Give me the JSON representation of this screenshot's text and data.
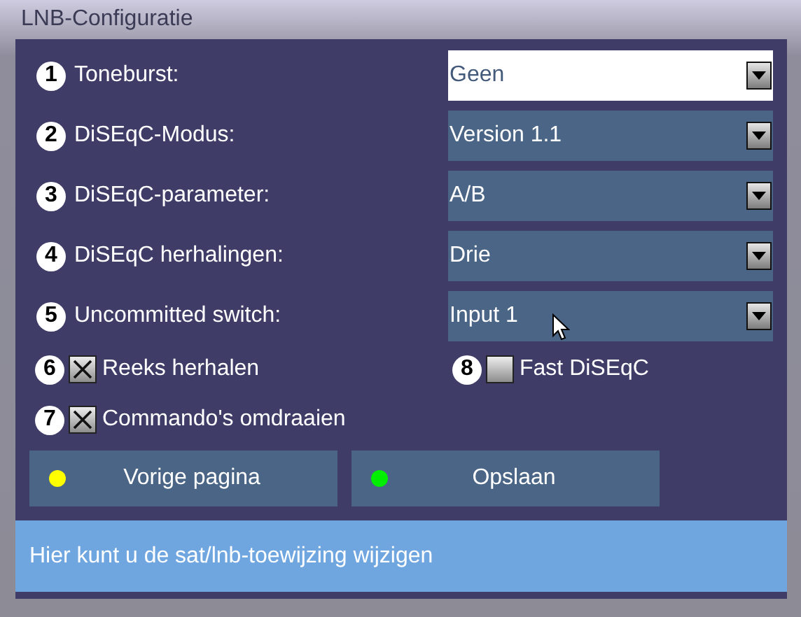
{
  "window": {
    "title": "LNB-Configuratie"
  },
  "settings": [
    {
      "number": "1",
      "label": "Toneburst:",
      "value": "Geen",
      "selected": true
    },
    {
      "number": "2",
      "label": "DiSEqC-Modus:",
      "value": "Version 1.1",
      "selected": false
    },
    {
      "number": "3",
      "label": "DiSEqC-parameter:",
      "value": "A/B",
      "selected": false
    },
    {
      "number": "4",
      "label": "DiSEqC herhalingen:",
      "value": "Drie",
      "selected": false
    },
    {
      "number": "5",
      "label": "Uncommitted switch:",
      "value": "Input 1",
      "selected": false
    }
  ],
  "options": [
    {
      "number": "6",
      "label": "Reeks herhalen",
      "checked": true
    },
    {
      "number": "8",
      "label": "Fast DiSEqC",
      "checked": false
    },
    {
      "number": "7",
      "label": "Commando's omdraaien",
      "checked": true
    }
  ],
  "buttons": [
    {
      "label": "Vorige pagina",
      "color": "#ffff00"
    },
    {
      "label": "Opslaan",
      "color": "#00ee00"
    }
  ],
  "status_bar": {
    "text": "Hier kunt u de sat/lnb-toewijzing wijzigen"
  }
}
